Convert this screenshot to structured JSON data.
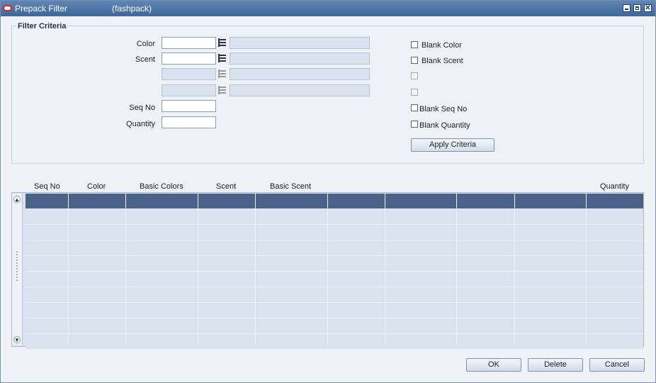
{
  "window": {
    "title": "Prepack Filter",
    "subtitle": "(fashpack)"
  },
  "filter": {
    "legend": "Filter Criteria",
    "color_label": "Color",
    "scent_label": "Scent",
    "seqno_label": "Seq No",
    "quantity_label": "Quantity",
    "color_value": "",
    "scent_value": "",
    "seqno_value": "",
    "quantity_value": ""
  },
  "checks": {
    "blank_color": "Blank Color",
    "blank_scent": "Blank Scent",
    "blank_seqno": "Blank Seq No",
    "blank_quantity": "Blank Quantity"
  },
  "apply_label": "Apply Criteria",
  "grid": {
    "columns": [
      "Seq No",
      "Color",
      "Basic Colors",
      "Scent",
      "Basic Scent",
      "Quantity"
    ],
    "row_count": 10,
    "selected_row": 0
  },
  "buttons": {
    "ok": "OK",
    "delete": "Delete",
    "cancel": "Cancel"
  },
  "colors": {
    "title_bg": "#3f669a",
    "selected_row": "#4a6188",
    "row_bg": "#d9e2ee"
  }
}
